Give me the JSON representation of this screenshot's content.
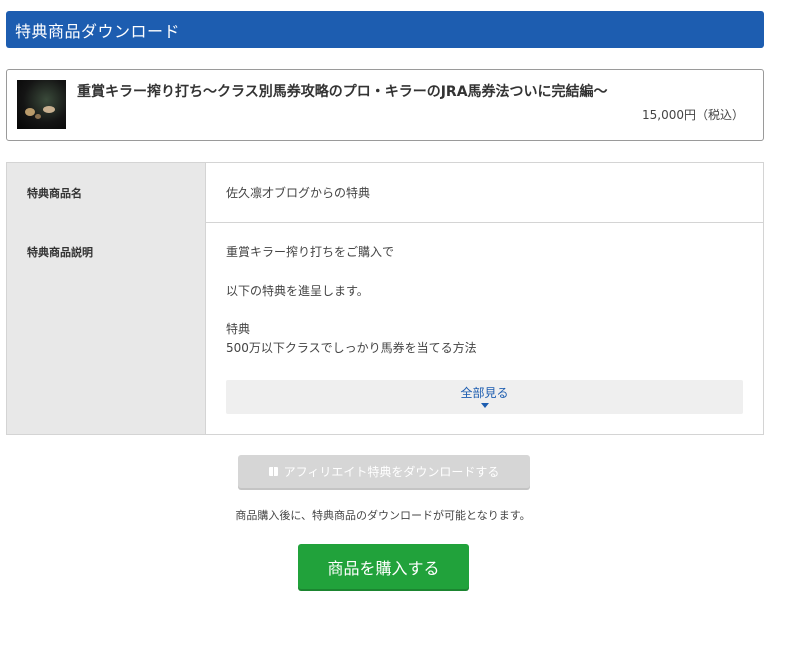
{
  "header": {
    "title": "特典商品ダウンロード"
  },
  "product": {
    "title": "重賞キラー搾り打ち〜クラス別馬券攻略のプロ・キラーのJRA馬券法ついに完結編〜",
    "price": "15,000円（税込）"
  },
  "details": {
    "name_label": "特典商品名",
    "name_value": "佐久凛才ブログからの特典",
    "desc_label": "特典商品説明",
    "desc_lines": [
      "重賞キラー搾り打ちをご購入で",
      "以下の特典を進呈します。",
      "特典",
      "500万以下クラスでしっかり馬券を当てる方法"
    ],
    "see_all": "全部見る"
  },
  "affiliate_button": {
    "label": "アフィリエイト特典をダウンロードする"
  },
  "notice": "商品購入後に、特典商品のダウンロードが可能となります。",
  "buy_button": {
    "label": "商品を購入する"
  },
  "colors": {
    "header": "#1d5db0",
    "buy": "#21a23b",
    "disabled": "#d6d6d6"
  }
}
